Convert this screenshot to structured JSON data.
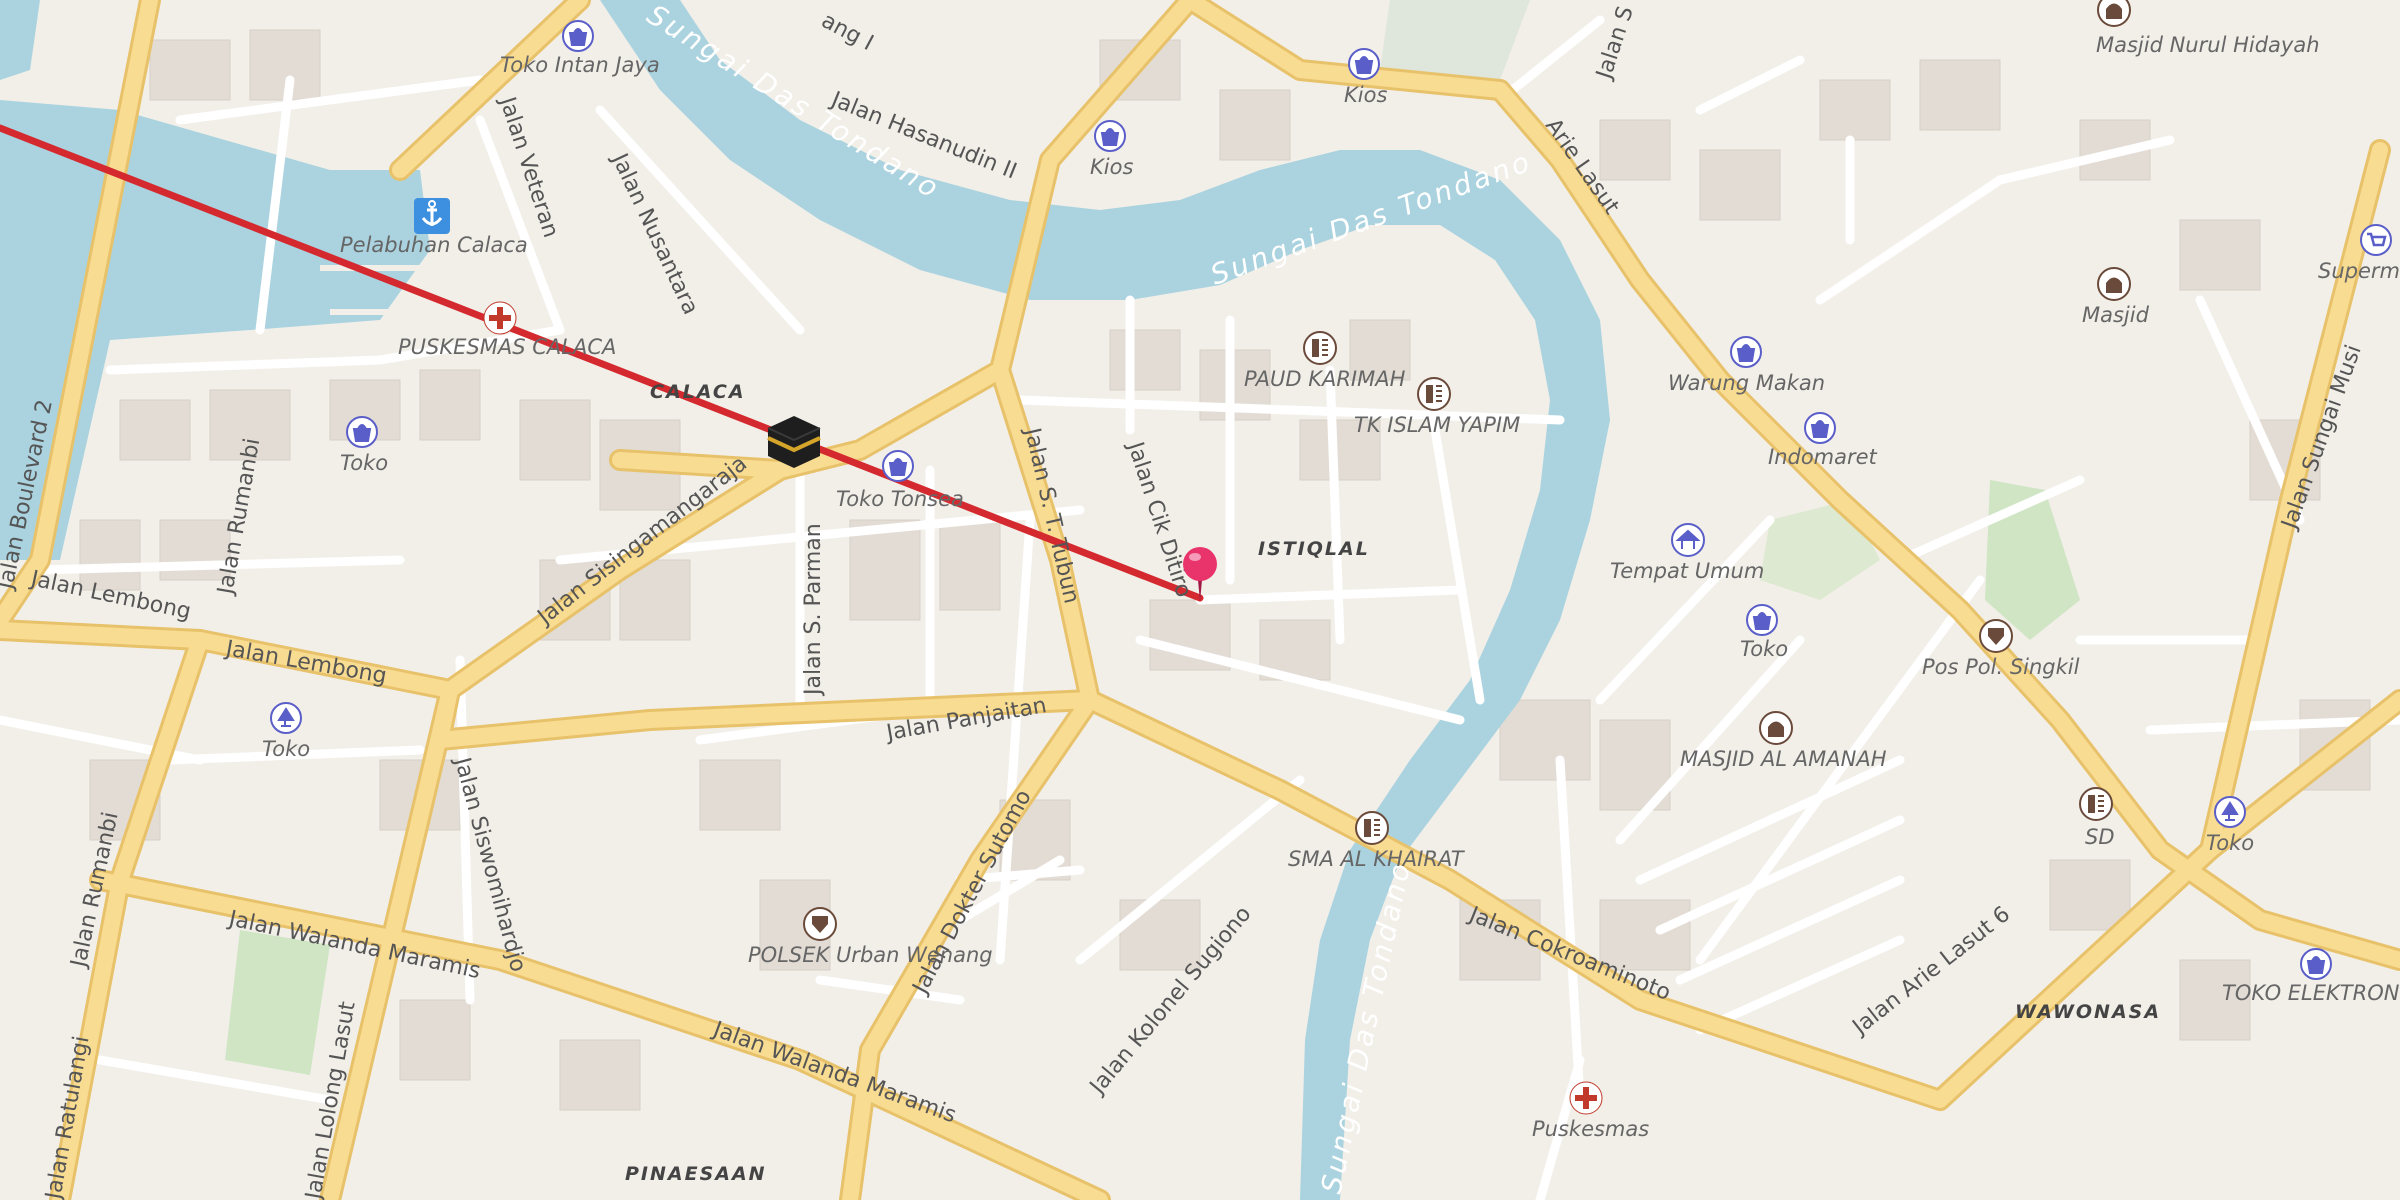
{
  "map": {
    "colors": {
      "background": "#f2efe9",
      "water": "#aad3df",
      "major_road": "#f7d88a",
      "road_casing": "#e8c26a",
      "minor_road": "#ffffff",
      "building": "#e3ddd5",
      "park": "#c8e6c0",
      "route_line": "#d42a2f",
      "pin": "#e8336b",
      "poi_shop": "#5a5ec8",
      "poi_amenity": "#6a4a3a",
      "poi_health": "#c0392b"
    },
    "rivers": [
      {
        "name": "Sungai Das Tondano"
      },
      {
        "name": "Sungai Das Tondano"
      },
      {
        "name": "Sungai Das Tondano"
      }
    ],
    "areas": [
      {
        "name": "CALACA"
      },
      {
        "name": "ISTIQLAL"
      },
      {
        "name": "WAWONASA"
      },
      {
        "name": "PINAESAAN"
      }
    ],
    "streets": [
      {
        "name": "Jalan Boulevard 2"
      },
      {
        "name": "Jalan Veteran"
      },
      {
        "name": "Jalan Nusantara"
      },
      {
        "name": "Jalan Hasanudin II"
      },
      {
        "name": "Arie Lasut"
      },
      {
        "name": "Jalan Sisingamangaraja"
      },
      {
        "name": "Jalan Rumanbi"
      },
      {
        "name": "Jalan Lembong"
      },
      {
        "name": "Jalan Lembong"
      },
      {
        "name": "Jalan S. Parman"
      },
      {
        "name": "Jalan S. T. Tubun"
      },
      {
        "name": "Jalan Cik Ditiro"
      },
      {
        "name": "Jalan Panjaitan"
      },
      {
        "name": "Jalan Siswomihardjo"
      },
      {
        "name": "Jalan Walanda Maramis"
      },
      {
        "name": "Jalan Walanda Maramis"
      },
      {
        "name": "Jalan Dokter Sutomo"
      },
      {
        "name": "Jalan Kolonel Sugiono"
      },
      {
        "name": "Jalan Cokroaminoto"
      },
      {
        "name": "Jalan Arie Lasut 6"
      },
      {
        "name": "Jalan Sungai Musi"
      },
      {
        "name": "Jalan Rumanbi"
      },
      {
        "name": "Jalan Ratulangi"
      },
      {
        "name": "Jalan Lolong Lasut"
      },
      {
        "name": "Jalan S"
      },
      {
        "name": "ang I"
      }
    ],
    "pois": [
      {
        "name": "Toko Intan Jaya",
        "icon": "shop-bag-icon"
      },
      {
        "name": "Pelabuhan Calaca",
        "icon": "anchor-icon"
      },
      {
        "name": "PUSKESMAS CALACA",
        "icon": "health-cross-icon"
      },
      {
        "name": "Toko",
        "icon": "shop-bag-icon"
      },
      {
        "name": "Toko",
        "icon": "lamp-shop-icon"
      },
      {
        "name": "Kios",
        "icon": "shop-bag-icon"
      },
      {
        "name": "Kios",
        "icon": "shop-bag-icon"
      },
      {
        "name": "Toko Tonsea",
        "icon": "shop-bag-icon"
      },
      {
        "name": "PAUD KARIMAH",
        "icon": "school-icon"
      },
      {
        "name": "TK ISLAM YAPIM",
        "icon": "school-icon"
      },
      {
        "name": "Warung Makan",
        "icon": "shop-bag-icon"
      },
      {
        "name": "Indomaret",
        "icon": "shop-bag-icon"
      },
      {
        "name": "Tempat Umum",
        "icon": "shelter-icon"
      },
      {
        "name": "Toko",
        "icon": "shop-bag-icon"
      },
      {
        "name": "MASJID AL AMANAH",
        "icon": "mosque-icon"
      },
      {
        "name": "SMA AL KHAIRAT",
        "icon": "school-icon"
      },
      {
        "name": "POLSEK Urban Wenang",
        "icon": "police-icon"
      },
      {
        "name": "Puskesmas",
        "icon": "health-cross-icon"
      },
      {
        "name": "Masjid Nurul Hidayah",
        "icon": "mosque-icon"
      },
      {
        "name": "Masjid",
        "icon": "mosque-icon"
      },
      {
        "name": "Supermarket",
        "icon": "cart-icon"
      },
      {
        "name": "Pos Pol. Singkil",
        "icon": "police-icon"
      },
      {
        "name": "SD",
        "icon": "school-icon"
      },
      {
        "name": "Toko",
        "icon": "lamp-shop-icon"
      },
      {
        "name": "TOKO ELEKTRONIK",
        "icon": "shop-bag-icon"
      }
    ],
    "markers": {
      "origin_icon": "kaaba-icon",
      "destination_icon": "map-pin-icon"
    }
  }
}
